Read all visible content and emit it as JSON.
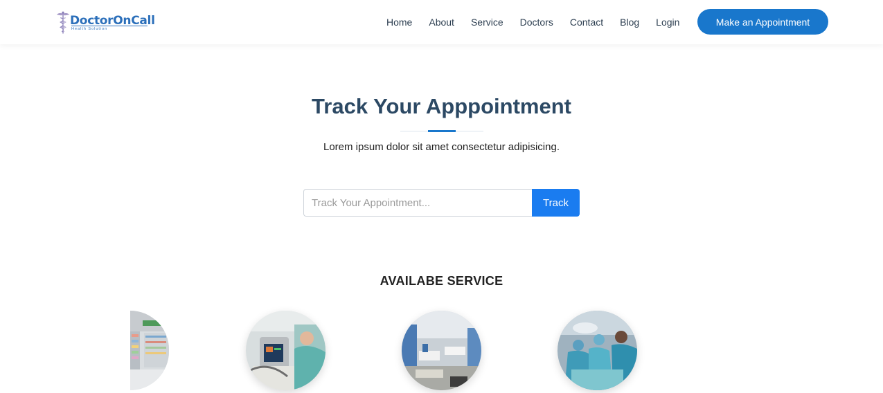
{
  "header": {
    "logo": {
      "name": "DoctorOnCall",
      "tagline": "Health Solution"
    },
    "nav": [
      "Home",
      "About",
      "Service",
      "Doctors",
      "Contact",
      "Blog",
      "Login"
    ],
    "cta_label": "Make an Appointment"
  },
  "hero": {
    "title": "Track Your Apppointment",
    "subtitle": "Lorem ipsum dolor sit amet consectetur adipisicing."
  },
  "track": {
    "placeholder": "Track Your Appointment...",
    "button_label": "Track"
  },
  "services": {
    "title": "AVAILABE SERVICE",
    "items": [
      "pharmacy-image",
      "medical-equipment-image",
      "hospital-ward-image",
      "surgery-image"
    ]
  },
  "colors": {
    "accent": "#1977cc",
    "heading": "#2c4964",
    "track_button": "#1a7cf0"
  }
}
